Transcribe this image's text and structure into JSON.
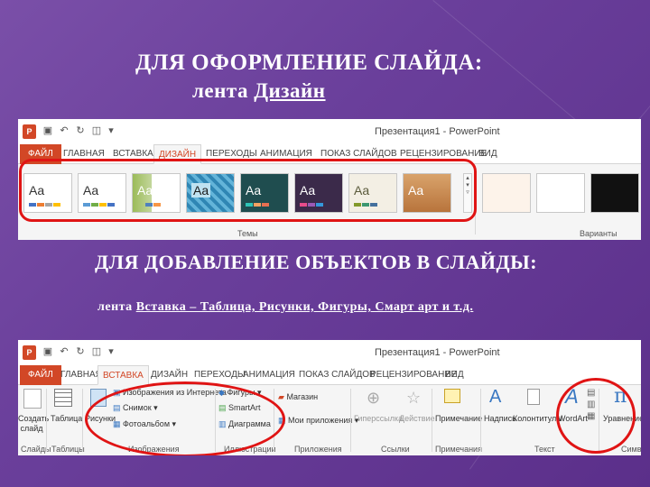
{
  "slide": {
    "title1": "ДЛЯ ОФОРМЛЕНИЕ СЛАЙДА:",
    "title2_prefix": "лента ",
    "title2_link": "Дизайн",
    "title3": "ДЛЯ ДОБАВЛЕНИЕ ОБЪЕКТОВ В СЛАЙДЫ:",
    "title4_prefix": "лента ",
    "title4_link": "Вставка – Таблица, Рисунки, Фигуры, Смарт арт и т.д."
  },
  "ribbon1": {
    "window_title": "Презентация1 - PowerPoint",
    "tabs": [
      "ФАЙЛ",
      "ГЛАВНАЯ",
      "ВСТАВКА",
      "ДИЗАЙН",
      "ПЕРЕХОДЫ",
      "АНИМАЦИЯ",
      "ПОКАЗ СЛАЙДОВ",
      "РЕЦЕНЗИРОВАНИЕ",
      "ВИД"
    ],
    "active_tab": "ДИЗАЙН",
    "themes_label": "Темы",
    "variants_label": "Варианты",
    "theme_text": "Aa"
  },
  "ribbon2": {
    "window_title": "Презентация1 - PowerPoint",
    "tabs": [
      "ФАЙЛ",
      "ГЛАВНАЯ",
      "ВСТАВКА",
      "ДИЗАЙН",
      "ПЕРЕХОДЫ",
      "АНИМАЦИЯ",
      "ПОКАЗ СЛАЙДОВ",
      "РЕЦЕНЗИРОВАНИЕ",
      "ВИД"
    ],
    "active_tab": "ВСТАВКА",
    "new_slide": "Создать слайд",
    "table": "Таблица",
    "pictures": "Рисунки",
    "online_pictures": "Изображения из Интернета",
    "screenshot": "Снимок",
    "photo_album": "Фотоальбом",
    "shapes": "Фигуры",
    "smartart": "SmartArt",
    "chart": "Диаграмма",
    "store": "Магазин",
    "my_apps": "Мои приложения",
    "hyperlink": "Гиперссылка",
    "action": "Действие",
    "comment": "Примечание",
    "textbox": "Надпись",
    "header_footer": "Колонтитулы",
    "wordart": "WordArt",
    "equation": "Уравнение",
    "groups": {
      "slides": "Слайды",
      "tables": "Таблицы",
      "images": "Изображения",
      "illustrations": "Иллюстрации",
      "apps": "Приложения",
      "links": "Ссылки",
      "comments": "Примечания",
      "text": "Текст",
      "symbols": "Симво"
    }
  },
  "colors": {
    "accent": "#d24726",
    "highlight": "#e01414"
  }
}
